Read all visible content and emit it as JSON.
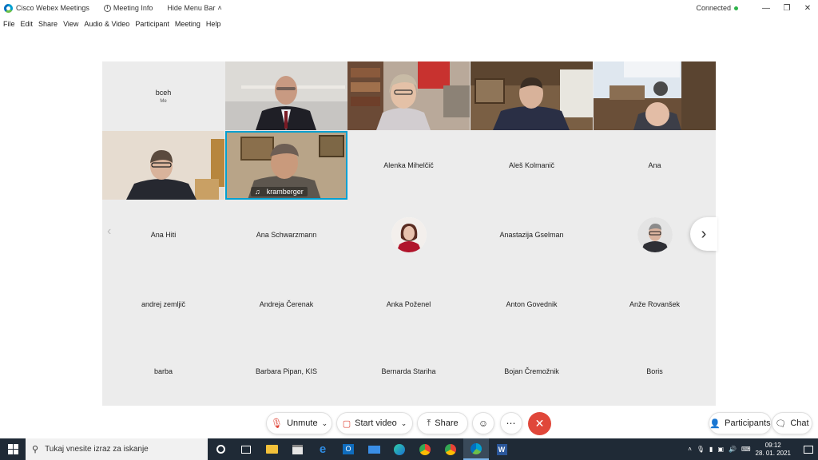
{
  "titlebar": {
    "app_name": "Cisco Webex Meetings",
    "meeting_info": "Meeting Info",
    "hide_menu": "Hide Menu Bar",
    "status": "Connected"
  },
  "menu": [
    "File",
    "Edit",
    "Share",
    "View",
    "Audio & Video",
    "Participant",
    "Meeting",
    "Help"
  ],
  "self_tile": {
    "name": "bceh",
    "sub": "Me"
  },
  "active_speaker": "kramberger",
  "participants": [
    "Alenka Mihelčič",
    "Aleš Kolmanič",
    "Ana",
    "Ana Hiti",
    "Ana Schwarzmann",
    "Anastazija Gselman",
    "andrej zemljič",
    "Andreja Čerenak",
    "Anka Poženel",
    "Anton Govednik",
    "Anže Rovanšek",
    "barba",
    "Barbara Pipan, KIS",
    "Bernarda Stariha",
    "Bojan Čremožnik",
    "Boris"
  ],
  "controls": {
    "unmute": "Unmute",
    "start_video": "Start video",
    "share": "Share",
    "participants": "Participants",
    "chat": "Chat"
  },
  "taskbar": {
    "search_placeholder": "Tukaj vnesite izraz za iskanje",
    "time": "09:12",
    "date": "28. 01. 2021"
  },
  "colors": {
    "accent": "#00a0d1",
    "end_call": "#e0473a",
    "mute_icon": "#e0473a",
    "taskbar": "#1f2a36"
  }
}
